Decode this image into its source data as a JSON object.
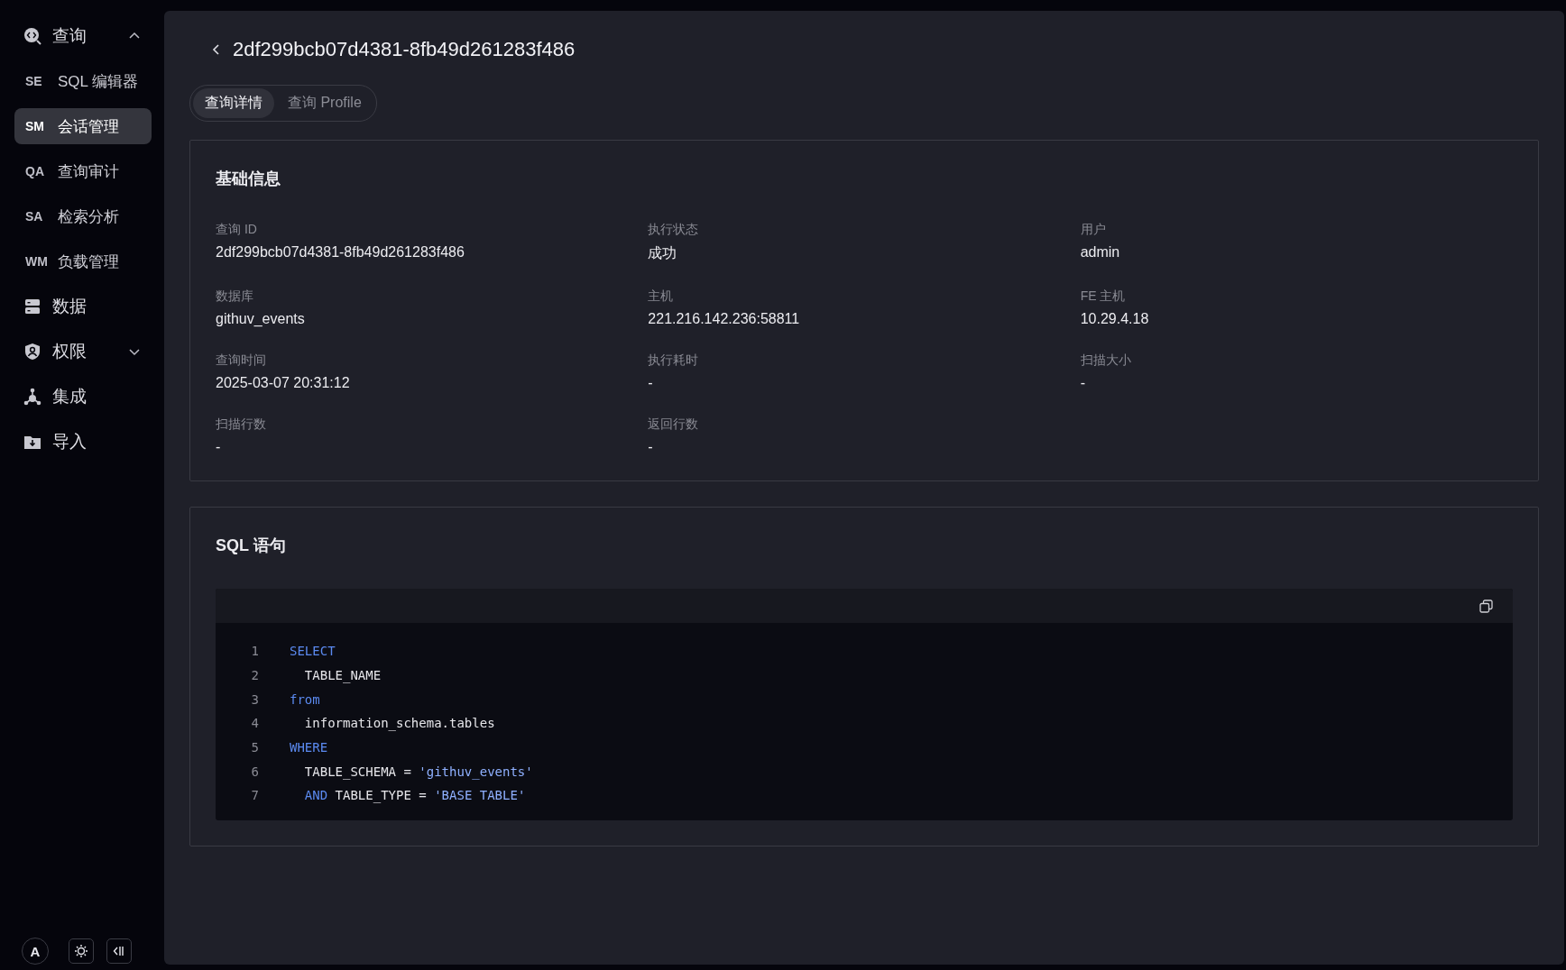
{
  "sidebar": {
    "items": [
      {
        "kind": "group",
        "label": "查询",
        "expanded": true
      },
      {
        "kind": "sub",
        "abbr": "SE",
        "label": "SQL 编辑器",
        "selected": false
      },
      {
        "kind": "sub",
        "abbr": "SM",
        "label": "会话管理",
        "selected": true
      },
      {
        "kind": "sub",
        "abbr": "QA",
        "label": "查询审计",
        "selected": false
      },
      {
        "kind": "sub",
        "abbr": "SA",
        "label": "检索分析",
        "selected": false
      },
      {
        "kind": "sub",
        "abbr": "WM",
        "label": "负载管理",
        "selected": false
      },
      {
        "kind": "group",
        "label": "数据"
      },
      {
        "kind": "group",
        "label": "权限",
        "expanded": false
      },
      {
        "kind": "group",
        "label": "集成"
      },
      {
        "kind": "group",
        "label": "导入"
      }
    ],
    "avatar": "A"
  },
  "header": {
    "title": "2df299bcb07d4381-8fb49d261283f486"
  },
  "tabs": [
    {
      "label": "查询详情",
      "selected": true
    },
    {
      "label": "查询 Profile",
      "selected": false
    }
  ],
  "basic_info": {
    "title": "基础信息",
    "fields": [
      {
        "label": "查询 ID",
        "value": "2df299bcb07d4381-8fb49d261283f486"
      },
      {
        "label": "执行状态",
        "value": "成功"
      },
      {
        "label": "用户",
        "value": "admin"
      },
      {
        "label": "数据库",
        "value": "githuv_events"
      },
      {
        "label": "主机",
        "value": "221.216.142.236:58811"
      },
      {
        "label": "FE 主机",
        "value": "10.29.4.18"
      },
      {
        "label": "查询时间",
        "value": "2025-03-07 20:31:12"
      },
      {
        "label": "执行耗时",
        "value": "-"
      },
      {
        "label": "扫描大小",
        "value": "-"
      },
      {
        "label": "扫描行数",
        "value": "-"
      },
      {
        "label": "返回行数",
        "value": "-"
      }
    ]
  },
  "sql": {
    "title": "SQL 语句",
    "lines": [
      {
        "number": "1",
        "tokens": [
          {
            "kind": "keyword",
            "text": "SELECT"
          }
        ]
      },
      {
        "number": "2",
        "tokens": [
          {
            "kind": "plain",
            "text": "  TABLE_NAME"
          }
        ]
      },
      {
        "number": "3",
        "tokens": [
          {
            "kind": "keyword",
            "text": "from"
          }
        ]
      },
      {
        "number": "4",
        "tokens": [
          {
            "kind": "plain",
            "text": "  information_schema.tables"
          }
        ]
      },
      {
        "number": "5",
        "tokens": [
          {
            "kind": "keyword",
            "text": "WHERE"
          }
        ]
      },
      {
        "number": "6",
        "tokens": [
          {
            "kind": "plain",
            "text": "  TABLE_SCHEMA = "
          },
          {
            "kind": "string",
            "text": "'githuv_events'"
          }
        ]
      },
      {
        "number": "7",
        "tokens": [
          {
            "kind": "keyword",
            "text": "  AND"
          },
          {
            "kind": "plain",
            "text": " TABLE_TYPE = "
          },
          {
            "kind": "string",
            "text": "'BASE TABLE'"
          }
        ]
      }
    ]
  }
}
